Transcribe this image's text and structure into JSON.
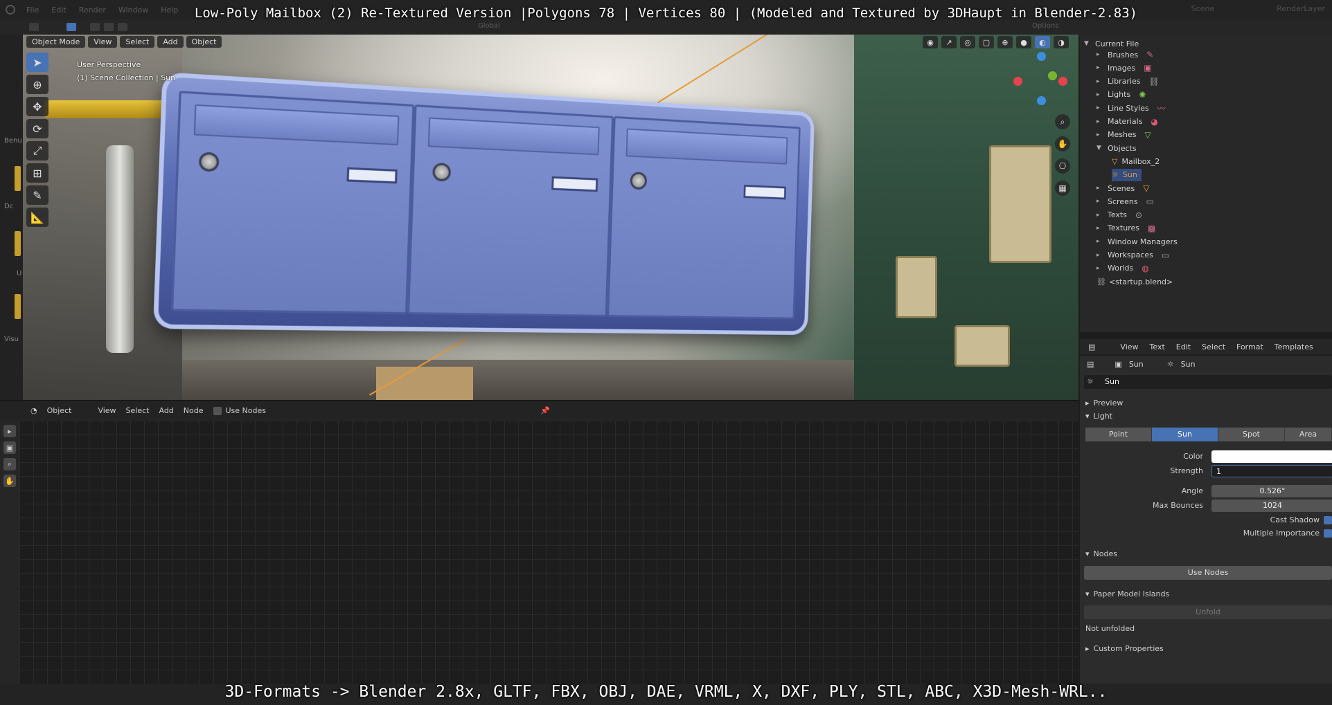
{
  "captions": {
    "top": "Low-Poly Mailbox (2) Re-Textured Version |Polygons 78 | Vertices 80 | (Modeled and Textured by 3DHaupt in Blender-2.83)",
    "bottom": "3D-Formats -> Blender 2.8x, GLTF, FBX, OBJ, DAE, VRML, X, DXF, PLY, STL, ABC, X3D-Mesh-WRL.."
  },
  "topbar": {
    "menus": [
      "File",
      "Edit",
      "Render",
      "Window",
      "Help"
    ],
    "scene": "Scene",
    "render_layer": "RenderLayer",
    "options": "Options"
  },
  "header2": {
    "transform": "Global"
  },
  "left_strip": {
    "labels": [
      "Benu",
      "Dc",
      "U",
      "Visu"
    ]
  },
  "viewport": {
    "mode": "Object Mode",
    "menus": [
      "View",
      "Select",
      "Add",
      "Object"
    ],
    "info_line1": "User Perspective",
    "info_line2": "(1) Scene Collection | Sun",
    "gizmo_colors": {
      "x": "#e8414f",
      "y": "#7ab32f",
      "z": "#3b8fe0"
    }
  },
  "node_editor": {
    "type": "Object",
    "menus": [
      "View",
      "Select",
      "Add",
      "Node"
    ],
    "use_nodes": "Use Nodes"
  },
  "outliner": {
    "root": "Current File",
    "items": [
      {
        "label": "Brushes",
        "icon": "brush-icon",
        "glyph": "✎",
        "color": "#d86a8a"
      },
      {
        "label": "Images",
        "icon": "image-icon",
        "glyph": "▣",
        "color": "#d86a8a"
      },
      {
        "label": "Libraries",
        "icon": "link-icon",
        "glyph": "⛓",
        "color": "#aaaaaa"
      },
      {
        "label": "Lights",
        "icon": "light-icon",
        "glyph": "✺",
        "color": "#7ec850"
      },
      {
        "label": "Line Styles",
        "icon": "linestyle-icon",
        "glyph": "〰",
        "color": "#d86a8a"
      },
      {
        "label": "Materials",
        "icon": "material-icon",
        "glyph": "◕",
        "color": "#e05b6e"
      },
      {
        "label": "Meshes",
        "icon": "mesh-icon",
        "glyph": "▽",
        "color": "#7ec850"
      },
      {
        "label": "Objects",
        "icon": "object-icon",
        "glyph": "",
        "color": "#cccccc"
      },
      {
        "label": "Mailbox_2",
        "icon": "mesh-object-icon",
        "glyph": "▽",
        "color": "#e69a3a"
      },
      {
        "label": "Sun",
        "icon": "sun-icon",
        "glyph": "☼",
        "color": "#e69a3a"
      },
      {
        "label": "Scenes",
        "icon": "scene-icon",
        "glyph": "▽",
        "color": "#e69a3a"
      },
      {
        "label": "Screens",
        "icon": "screen-icon",
        "glyph": "▭",
        "color": "#aaaaaa"
      },
      {
        "label": "Texts",
        "icon": "text-icon",
        "glyph": "⊙",
        "color": "#aaaaaa"
      },
      {
        "label": "Textures",
        "icon": "texture-icon",
        "glyph": "▩",
        "color": "#d86a8a"
      },
      {
        "label": "Window Managers",
        "icon": "window-manager-icon",
        "glyph": "",
        "color": "#aaaaaa"
      },
      {
        "label": "Workspaces",
        "icon": "workspace-icon",
        "glyph": "▭",
        "color": "#aaaaaa"
      },
      {
        "label": "Worlds",
        "icon": "world-icon",
        "glyph": "◍",
        "color": "#e05b6e"
      }
    ],
    "footer": "<startup.blend>"
  },
  "properties": {
    "editor_menus": [
      "View",
      "Text",
      "Edit",
      "Select",
      "Format",
      "Templates"
    ],
    "breadcrumb": [
      "Sun",
      "Sun"
    ],
    "datablock": "Sun",
    "preview": "Preview",
    "light_panel": "Light",
    "light_types": [
      "Point",
      "Sun",
      "Spot",
      "Area"
    ],
    "light_active": "Sun",
    "color_label": "Color",
    "strength_label": "Strength",
    "strength_value": "1",
    "angle_label": "Angle",
    "angle_value": "0.526°",
    "max_bounces_label": "Max Bounces",
    "max_bounces_value": "1024",
    "cast_shadow": "Cast Shadow",
    "multiple_importance": "Multiple Importance",
    "nodes_panel": "Nodes",
    "use_nodes_btn": "Use Nodes",
    "paper_panel": "Paper Model Islands",
    "unfold_btn": "Unfold",
    "not_unfolded": "Not unfolded",
    "custom_props": "Custom Properties"
  }
}
